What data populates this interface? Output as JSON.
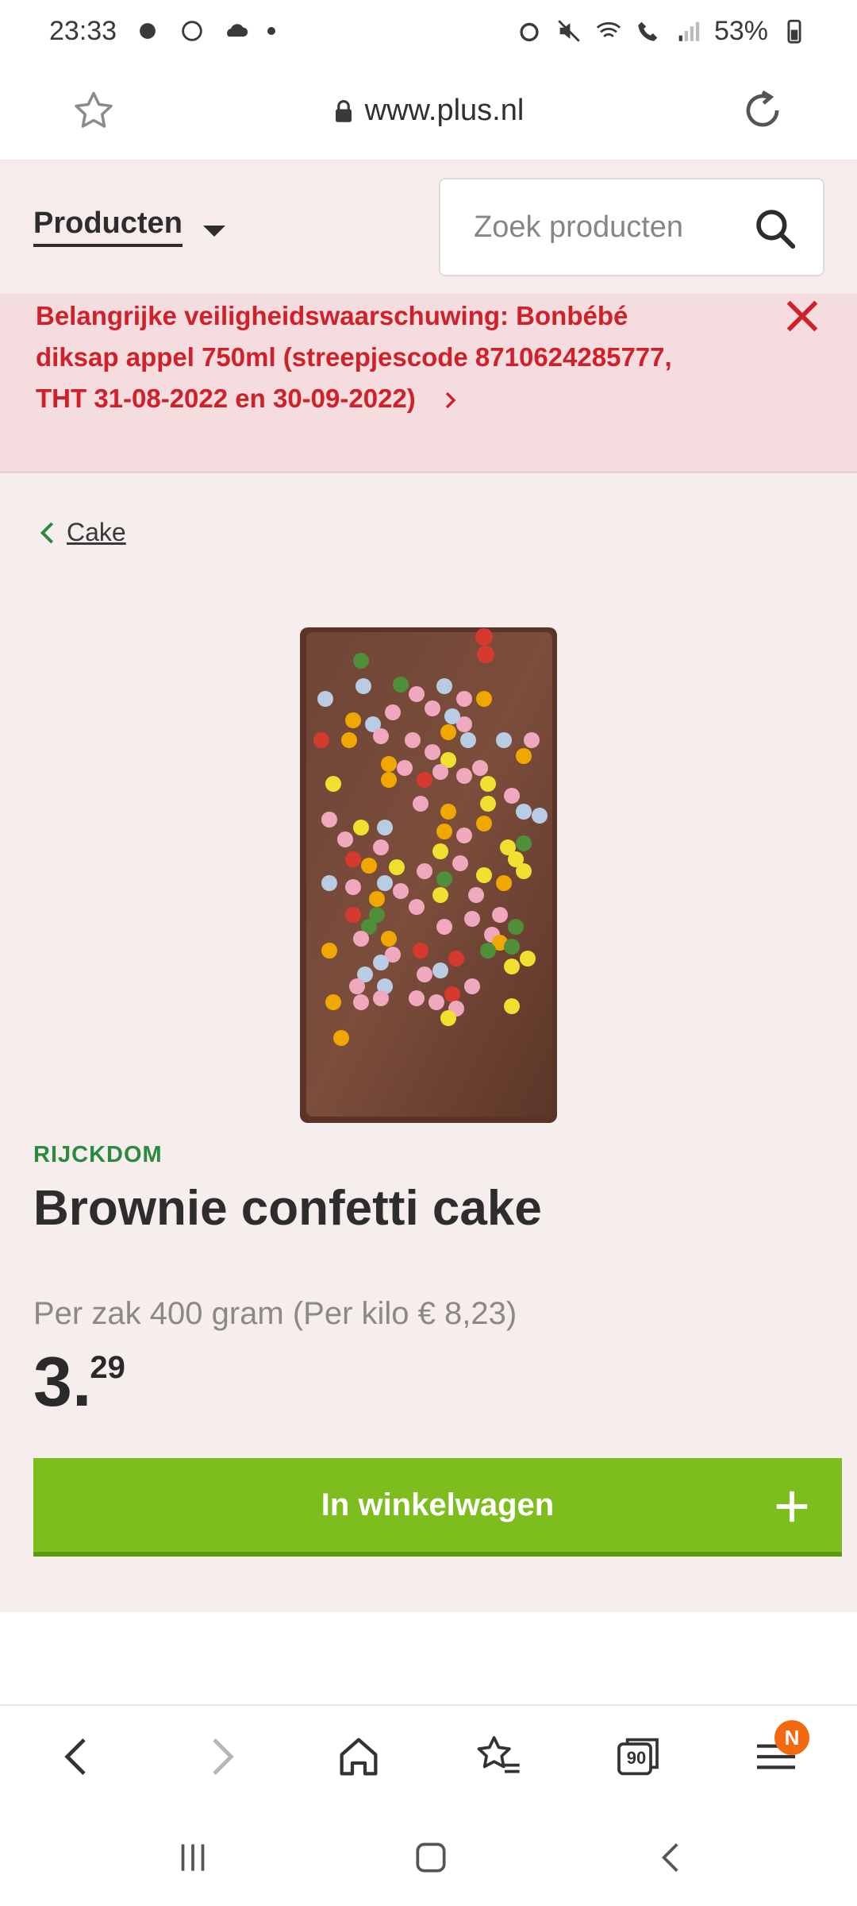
{
  "status_bar": {
    "time": "23:33",
    "battery": "53%"
  },
  "browser": {
    "url": "www.plus.nl"
  },
  "header": {
    "products_label": "Producten",
    "search_placeholder": "Zoek producten"
  },
  "alert": {
    "text": "Belangrijke veiligheidswaarschuwing: Bonbébé diksap appel 750ml (streepjescode 8710624285777, THT 31-08-2022 en 30-09-2022)"
  },
  "breadcrumb": {
    "label": "Cake"
  },
  "product": {
    "brand": "RIJCKDOM",
    "title": "Brownie confetti cake",
    "unit_info": "Per zak 400 gram (Per kilo € 8,23)",
    "price_euros": "3",
    "price_cents": "29",
    "add_to_cart_label": "In winkelwagen"
  },
  "toolbar": {
    "tabs_count": "90",
    "menu_badge": "N"
  },
  "colors": {
    "alert_red": "#d0202a",
    "brand_green": "#2b8a3e",
    "cart_green": "#7dbe1e",
    "badge_orange": "#f26a10"
  }
}
